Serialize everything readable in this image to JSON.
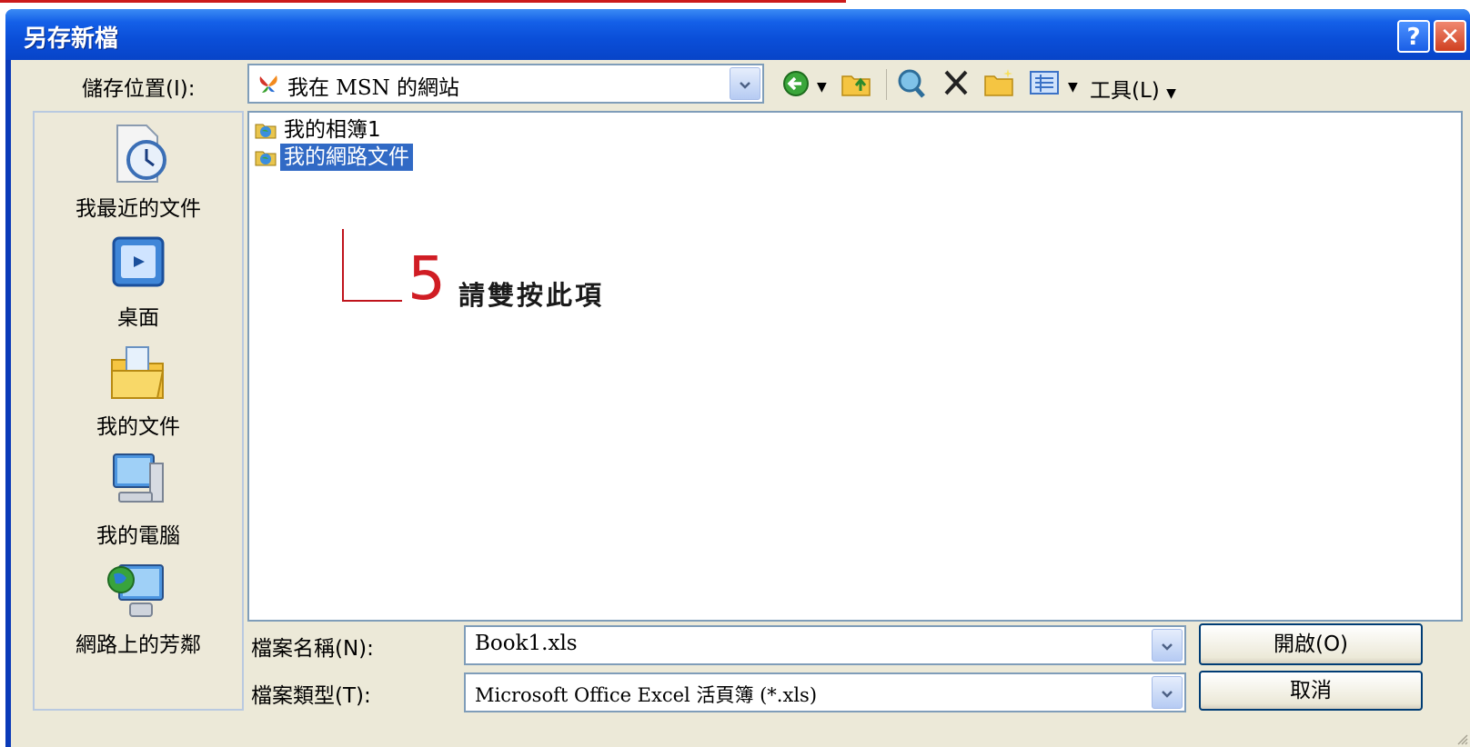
{
  "dialog": {
    "title": "另存新檔",
    "help_label": "?",
    "close_label": "✕"
  },
  "location": {
    "label": "儲存位置(I):",
    "value": "我在 MSN 的網站"
  },
  "toolbar": {
    "tools_label": "工具(L)",
    "icons": [
      "back-icon",
      "up-folder-icon",
      "search-web-icon",
      "delete-icon",
      "new-folder-icon",
      "views-icon"
    ]
  },
  "places": [
    {
      "label": "我最近的文件",
      "icon": "recent-docs-icon"
    },
    {
      "label": "桌面",
      "icon": "desktop-icon"
    },
    {
      "label": "我的文件",
      "icon": "my-documents-icon"
    },
    {
      "label": "我的電腦",
      "icon": "my-computer-icon"
    },
    {
      "label": "網路上的芳鄰",
      "icon": "network-places-icon"
    }
  ],
  "files": [
    {
      "name": "我的相簿1",
      "selected": false
    },
    {
      "name": "我的網路文件",
      "selected": true
    }
  ],
  "annotation": {
    "number": "5",
    "text": "請雙按此項"
  },
  "filename": {
    "label": "檔案名稱(N):",
    "value": "Book1.xls"
  },
  "filetype": {
    "label": "檔案類型(T):",
    "value": "Microsoft Office Excel 活頁簿 (*.xls)"
  },
  "buttons": {
    "open": "開啟(O)",
    "cancel": "取消"
  },
  "colors": {
    "annotation": "#d01d24",
    "selection": "#316ac5",
    "titlebar": "#0a4ed8"
  }
}
